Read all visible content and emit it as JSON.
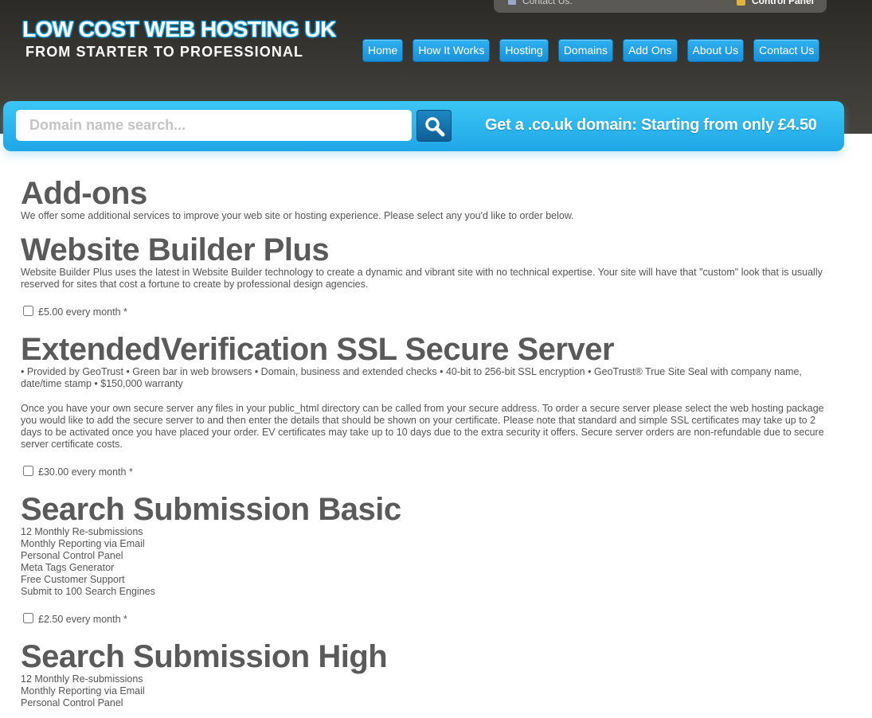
{
  "header": {
    "logo_title": "LOW COST WEB HOSTING UK",
    "logo_subtitle": "FROM STARTER TO PROFESSIONAL",
    "topbar_contact": "Contact Us:",
    "topbar_control_panel": "Control Panel",
    "nav": [
      "Home",
      "How It Works",
      "Hosting",
      "Domains",
      "Add Ons",
      "About Us",
      "Contact Us"
    ]
  },
  "search": {
    "placeholder": "Domain name search...",
    "promo": "Get a .co.uk domain: Starting from only £4.50"
  },
  "page": {
    "title": "Add-ons",
    "intro": "We offer some additional services to improve your web site or hosting experience. Please select any you'd like to order below."
  },
  "addons": {
    "builder": {
      "title": "Website Builder Plus",
      "desc": "Website Builder Plus uses the latest in Website Builder technology to create a dynamic and vibrant site with no technical expertise. Your site will have that \"custom\" look that is usually reserved for sites that cost a fortune to create by professional design agencies.",
      "price": "£5.00 every month *"
    },
    "ssl": {
      "title": "ExtendedVerification SSL Secure Server",
      "features": "• Provided by GeoTrust • Green bar in web browsers • Domain, business and extended checks • 40-bit to 256-bit SSL encryption • GeoTrust® True Site Seal with company name, date/time stamp • $150,000 warranty",
      "desc": "Once you have your own secure server any files in your public_html directory can be called from your secure address. To order a secure server please select the web hosting package you would like to add the secure server to and then enter the details that should be shown on your certificate. Please note that standard and simple SSL certificates may take up to 2 days to be activated once you have placed your order. EV certificates may take up to 10 days due to the extra security it offers. Secure server orders are non-refundable due to secure server certificate costs.",
      "price": "£30.00 every month *"
    },
    "search_basic": {
      "title": "Search Submission Basic",
      "items": [
        "12 Monthly Re-submissions",
        "Monthly Reporting via Email",
        "Personal Control Panel",
        "Meta Tags Generator",
        "Free Customer Support",
        "Submit to 100 Search Engines"
      ],
      "price": "£2.50 every month *"
    },
    "search_high": {
      "title": "Search Submission High",
      "items": [
        "12 Monthly Re-submissions",
        "Monthly Reporting via Email",
        "Personal Control Panel"
      ]
    }
  },
  "colors": {
    "accent": "#1ea6e6",
    "header_bg": "#3a3935",
    "heading": "#5a5a5a"
  }
}
